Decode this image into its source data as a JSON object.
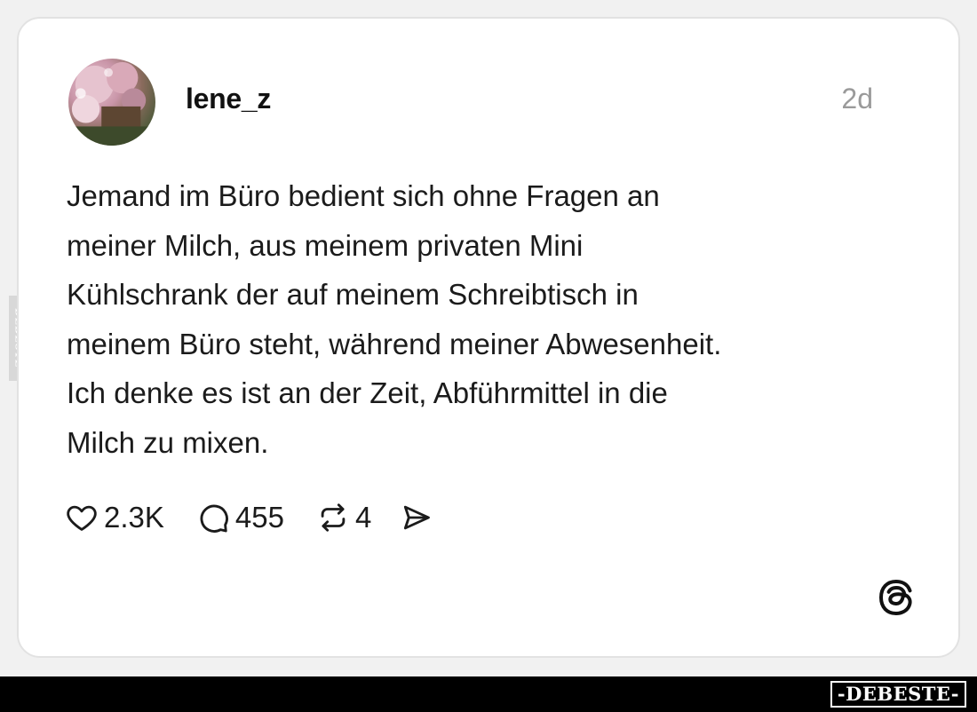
{
  "post": {
    "username": "lene_z",
    "timestamp": "2d",
    "text": "Jemand im Büro bedient sich ohne Fragen an\nmeiner Milch, aus meinem privaten Mini\nKühlschrank der auf meinem Schreibtisch in\nmeinem Büro steht, während meiner Abwesenheit.\nIch denke es ist an der Zeit, Abführmittel in die\nMilch zu mixen."
  },
  "actions": {
    "likes": {
      "icon": "heart-icon",
      "count": "2.3K"
    },
    "comments": {
      "icon": "comment-icon",
      "count": "455"
    },
    "reposts": {
      "icon": "repost-icon",
      "count": "4"
    },
    "share": {
      "icon": "send-icon"
    }
  },
  "branding": {
    "app_logo": "threads-logo-icon",
    "side_watermark": "DEBESTE",
    "bottom_watermark": "-DEBESTE-"
  },
  "colors": {
    "background": "#f1f1f1",
    "card": "#ffffff",
    "text": "#1b1b1b",
    "muted": "#9a9a9a",
    "bar": "#000000"
  }
}
